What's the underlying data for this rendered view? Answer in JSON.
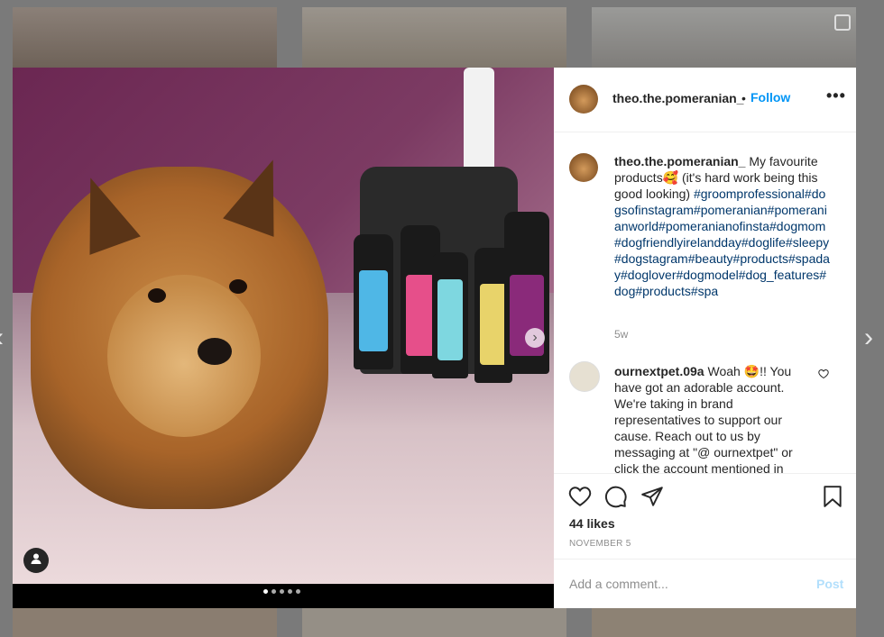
{
  "post": {
    "username": "theo.the.pomeranian_",
    "separator": "•",
    "follow_label": "Follow",
    "more_label": "•••",
    "caption_text": " My favourite products🥰 (it's hard work being this good looking) ",
    "caption_tags": "#groomprofessional#dogsofinstagram#pomeranian#pomeranianworld#pomeranianofinsta#dogmom#dogfriendlyirelandday#doglife#sleepy#dogstagram#beauty#products#spaday#doglover#dogmodel#dog_features#dog#products#spa",
    "caption_time": "5w",
    "likes": "44 likes",
    "date": "NOVEMBER 5",
    "carousel": {
      "count": 5,
      "active": 0
    }
  },
  "comments": [
    {
      "username": "ournextpet.09a",
      "text": " Woah 🤩!! You have got an adorable account. We're taking in brand representatives to support our cause. Reach out to us by messaging at \"@ ournextpet\" or click the account mentioned in"
    }
  ],
  "add_comment": {
    "placeholder": "Add a comment...",
    "post_label": "Post"
  },
  "icons": [
    "heart-icon",
    "comment-icon",
    "share-icon",
    "bookmark-icon",
    "tag-user-icon",
    "next-arrow-icon"
  ],
  "colors": {
    "accent": "#0095f6",
    "hashtag": "#00376b",
    "post_disabled": "#b2dffc"
  }
}
